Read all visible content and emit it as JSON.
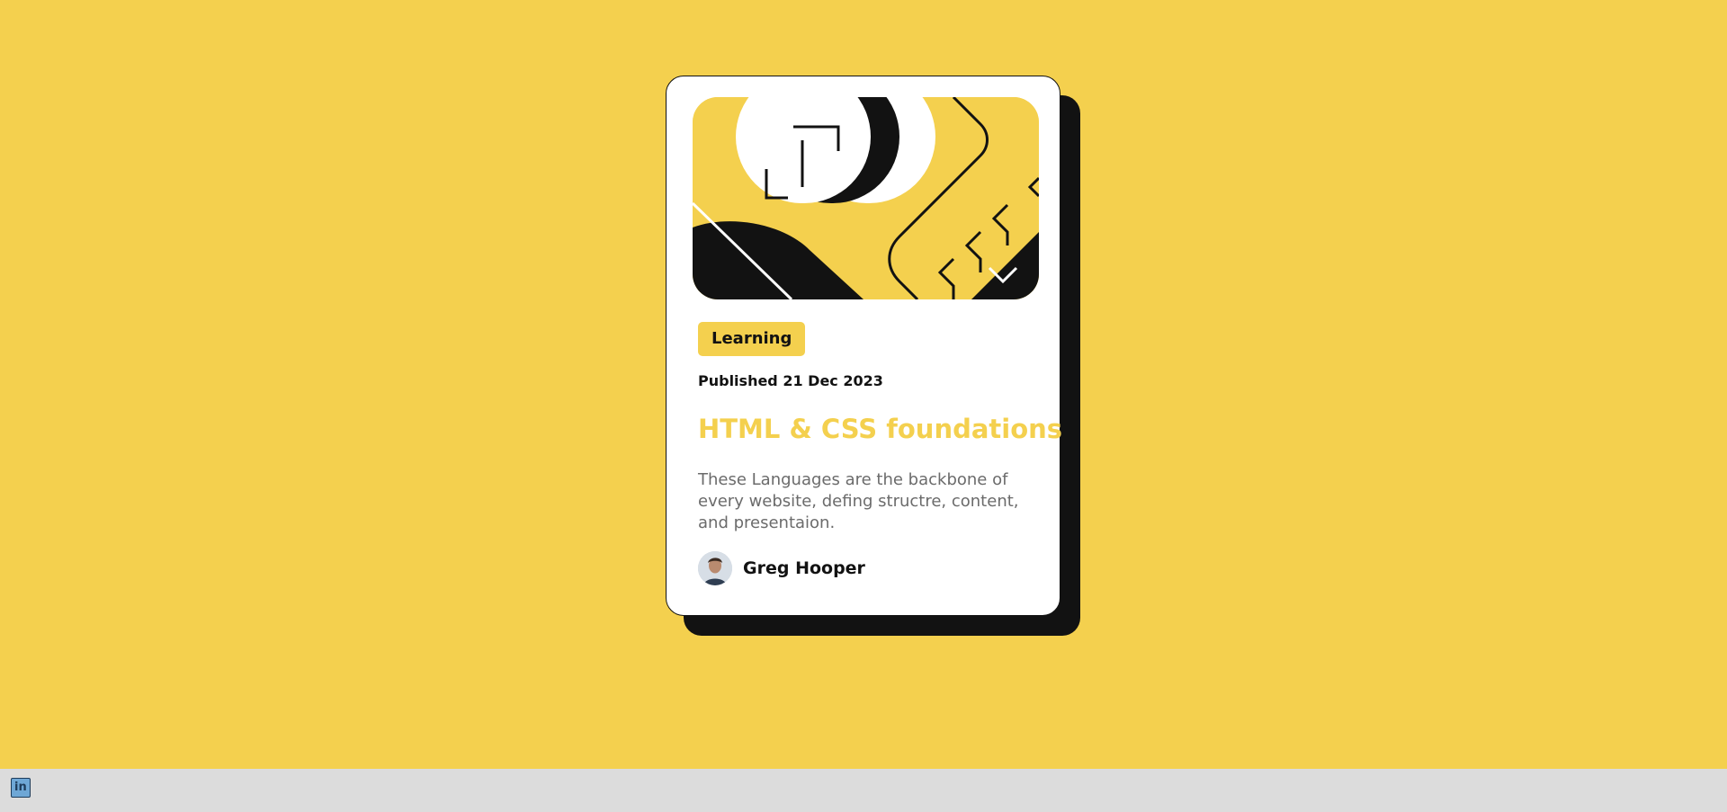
{
  "card": {
    "tag": "Learning",
    "published": "Published 21 Dec 2023",
    "title": "HTML & CSS foundations",
    "description": "These Languages are the backbone of every website, defing structre, content, and presentaion.",
    "author": "Greg Hooper"
  },
  "icons": {
    "linkedin": "linkedin-icon",
    "linkedin_glyph": "in"
  },
  "colors": {
    "background": "#f4d04e",
    "text": "#121212",
    "muted": "#6b6b6b",
    "card": "#ffffff",
    "footer": "#dcdcdc"
  }
}
